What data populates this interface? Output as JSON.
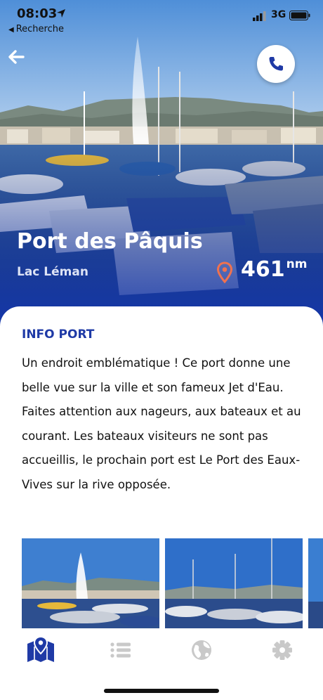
{
  "status_bar": {
    "time": "08:03",
    "back_app": "Recherche",
    "network": "3G"
  },
  "hero": {
    "title": "Port des Pâquis",
    "subtitle": "Lac Léman",
    "distance_value": "461",
    "distance_unit": "nm"
  },
  "info": {
    "title": "INFO PORT",
    "text": "Un endroit emblématique ! Ce port donne une belle vue sur la ville et son fameux Jet d'Eau. Faites attention aux nageurs, aux bateaux et au courant. Les bateaux visiteurs ne sont pas accueillis, le prochain port est Le Port des Eaux-Vives sur la rive opposée."
  },
  "icons": {
    "back": "arrow-left-icon",
    "call": "phone-icon",
    "pin": "map-pin-icon",
    "tabs": [
      "map-icon",
      "list-icon",
      "globe-icon",
      "gear-icon"
    ]
  },
  "colors": {
    "accent": "#1f3aa6",
    "pin": "#f0724f",
    "tab_inactive": "#c9c9c9"
  }
}
